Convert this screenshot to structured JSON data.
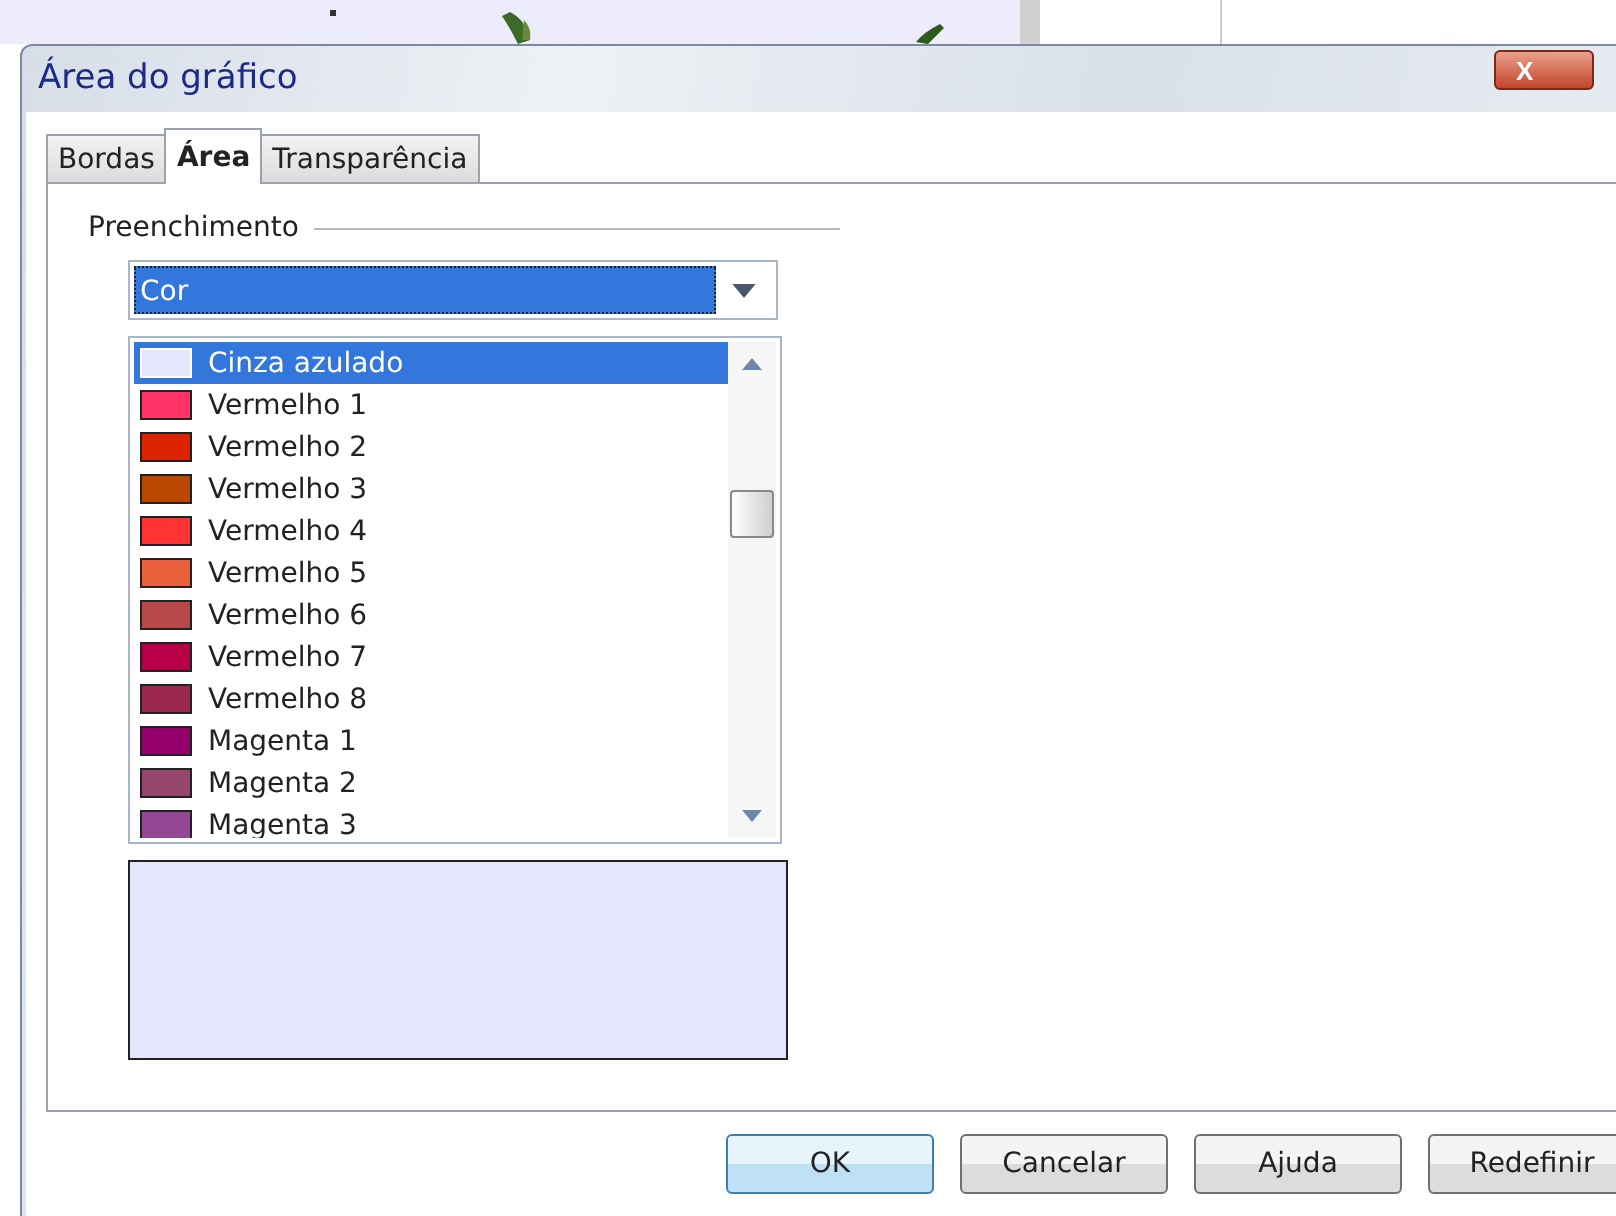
{
  "window": {
    "title": "Área do gráfico",
    "close": "X"
  },
  "tabs": [
    {
      "label": "Bordas",
      "selected": false
    },
    {
      "label": "Área",
      "selected": true
    },
    {
      "label": "Transparência",
      "selected": false
    }
  ],
  "fill": {
    "label": "Preenchimento",
    "type_dropdown": {
      "value": "Cor"
    },
    "colors": [
      {
        "name": "Cinza azulado",
        "color": "#e6e6ff",
        "selected": true
      },
      {
        "name": "Vermelho 1",
        "color": "#ff3366",
        "selected": false
      },
      {
        "name": "Vermelho 2",
        "color": "#dc2300",
        "selected": false
      },
      {
        "name": "Vermelho 3",
        "color": "#b84700",
        "selected": false
      },
      {
        "name": "Vermelho 4",
        "color": "#ff3333",
        "selected": false
      },
      {
        "name": "Vermelho 5",
        "color": "#eb613d",
        "selected": false
      },
      {
        "name": "Vermelho 6",
        "color": "#b84747",
        "selected": false
      },
      {
        "name": "Vermelho 7",
        "color": "#b80047",
        "selected": false
      },
      {
        "name": "Vermelho 8",
        "color": "#99284c",
        "selected": false
      },
      {
        "name": "Magenta 1",
        "color": "#94006b",
        "selected": false
      },
      {
        "name": "Magenta 2",
        "color": "#94476b",
        "selected": false
      },
      {
        "name": "Magenta 3",
        "color": "#944794",
        "selected": false
      }
    ]
  },
  "buttons": [
    {
      "label": "OK",
      "default": true
    },
    {
      "label": "Cancelar",
      "default": false
    },
    {
      "label": "Ajuda",
      "default": false
    },
    {
      "label": "Redefinir",
      "default": false
    }
  ]
}
